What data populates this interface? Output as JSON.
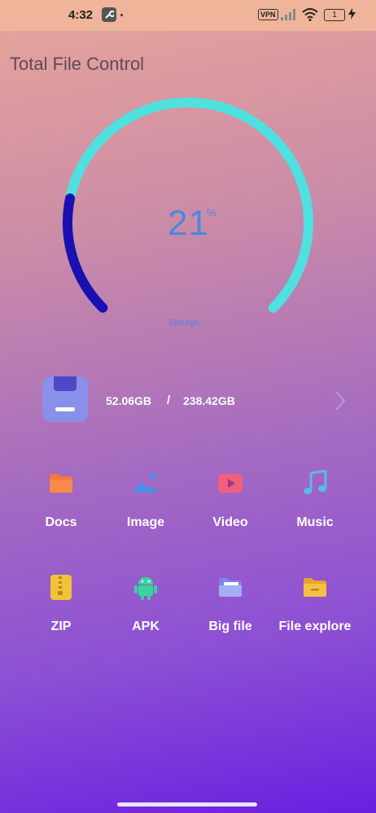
{
  "status_bar": {
    "time": "4:32",
    "vpn_label": "VPN",
    "battery_level": "1",
    "icons": [
      "wrench-icon",
      "signal-icon",
      "wifi-icon",
      "battery-icon",
      "charging-bolt-icon"
    ]
  },
  "app": {
    "title": "Total File Control"
  },
  "gauge": {
    "percent": 21,
    "value_text": "21",
    "unit_text": "%",
    "label": "Storage",
    "track_color": "#4fe0e0",
    "fill_color": "#1a10b0",
    "text_color": "#4f86e0"
  },
  "storage": {
    "used": "52.06GB",
    "separator": "/",
    "total": "238.42GB",
    "icon": "storage-icon",
    "icon_color": "#8a90ea"
  },
  "categories": [
    {
      "label": "Docs",
      "icon": "folder-icon",
      "color": "#f57a3a"
    },
    {
      "label": "Image",
      "icon": "image-icon",
      "color": "#4a8ee8"
    },
    {
      "label": "Video",
      "icon": "video-icon",
      "color": "#f0607a"
    },
    {
      "label": "Music",
      "icon": "music-icon",
      "color": "#5ab8f0"
    },
    {
      "label": "ZIP",
      "icon": "zip-icon",
      "color": "#f2c23a"
    },
    {
      "label": "APK",
      "icon": "android-icon",
      "color": "#3bd3a0"
    },
    {
      "label": "Big file",
      "icon": "big-file-folder-icon",
      "color": "#8a98f0"
    },
    {
      "label": "File explore",
      "icon": "file-explore-folder-icon",
      "color": "#f2b23a"
    }
  ]
}
